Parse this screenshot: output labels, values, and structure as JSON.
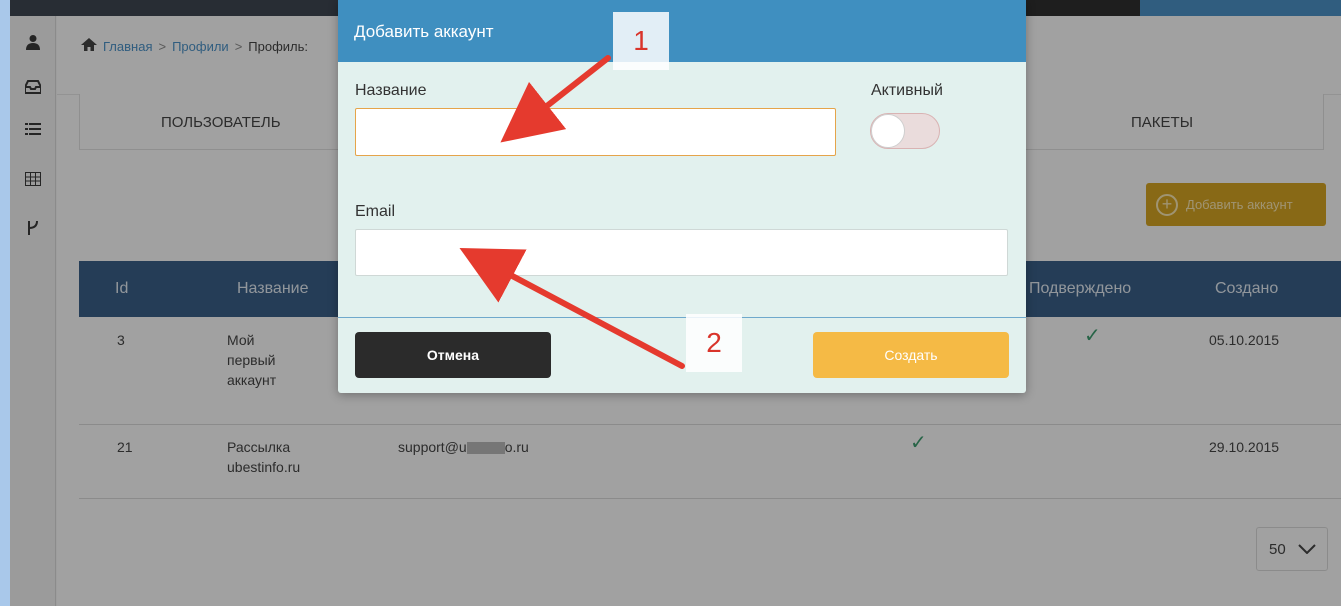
{
  "sidebar": {
    "icons": [
      "user-icon",
      "inbox-icon",
      "list-icon",
      "table-icon",
      "branch-icon"
    ]
  },
  "breadcrumb": {
    "items": [
      "Главная",
      "Профили",
      "Профиль:"
    ]
  },
  "tabs": {
    "user": "ПОЛЬЗОВАТЕЛЬ",
    "packages": "ПАКЕТЫ"
  },
  "toolbar": {
    "add_account": "Добавить аккаунт"
  },
  "table": {
    "headers": {
      "id": "Id",
      "name": "Название",
      "confirmed": "Подверждено",
      "created": "Создано"
    },
    "rows": [
      {
        "id": "3",
        "name_lines": [
          "Мой",
          "первый",
          "аккаунт"
        ],
        "email": "",
        "confirmed": "✓",
        "created": "05.10.2015"
      },
      {
        "id": "21",
        "name_lines": [
          "Рассылка",
          "ubestinfo.ru"
        ],
        "email": "support@u",
        "email_tail": "o.ru",
        "active": "✓",
        "created": "29.10.2015"
      }
    ]
  },
  "pager": {
    "per_page": "50"
  },
  "modal": {
    "title": "Добавить аккаунт",
    "name_label": "Название",
    "name_value": "",
    "active_label": "Активный",
    "active_on": false,
    "email_label": "Email",
    "email_value": "",
    "cancel": "Отмена",
    "create": "Создать"
  },
  "annotations": {
    "marker1": "1",
    "marker2": "2",
    "arrow_color": "#e53a2e"
  }
}
